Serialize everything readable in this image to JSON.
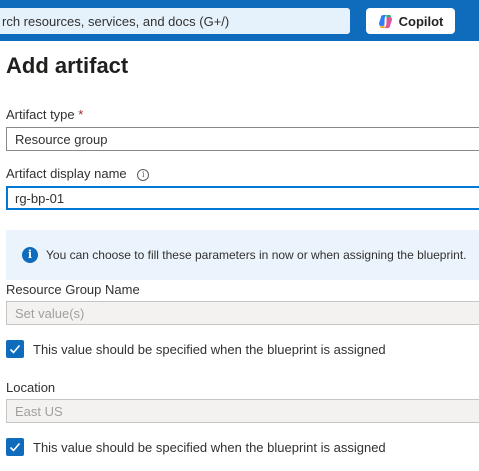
{
  "topbar": {
    "search_placeholder": "rch resources, services, and docs (G+/)",
    "copilot_label": "Copilot"
  },
  "page": {
    "title": "Add artifact"
  },
  "artifact_type": {
    "label": "Artifact type",
    "required_mark": "*",
    "value": "Resource group"
  },
  "display_name": {
    "label": "Artifact display name",
    "info_glyph": "i",
    "value": "rg-bp-01"
  },
  "info_banner": {
    "icon_glyph": "i",
    "text": "You can choose to fill these parameters in now or when assigning the blueprint."
  },
  "resource_group_name": {
    "label": "Resource Group Name",
    "placeholder": "Set value(s)",
    "checkbox_label": "This value should be specified when the blueprint is assigned",
    "checked": true
  },
  "location": {
    "label": "Location",
    "value": "East US",
    "checkbox_label": "This value should be specified when the blueprint is assigned",
    "checked": true
  },
  "colors": {
    "accent": "#0f6cbd",
    "required": "#a4262c",
    "info_bg": "#ebf3fc"
  }
}
